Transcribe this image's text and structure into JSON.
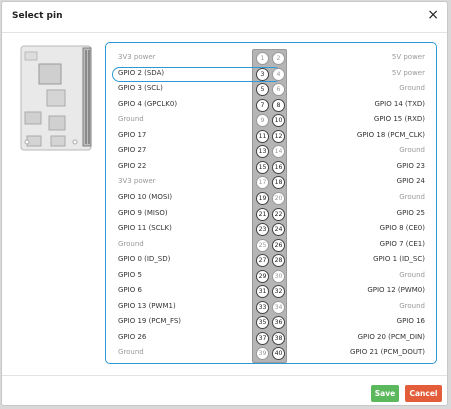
{
  "dialog": {
    "title": "Select pin",
    "close_glyph": "×",
    "save_label": "Save",
    "cancel_label": "Cancel"
  },
  "colors": {
    "accent": "#2d98d6",
    "save": "#5cb85c",
    "cancel": "#e35d3a"
  },
  "selected_pin": 3,
  "pins": [
    {
      "left": {
        "num": "1",
        "label": "3V3 power",
        "muted": true
      },
      "right": {
        "num": "2",
        "label": "5V power",
        "muted": true
      }
    },
    {
      "left": {
        "num": "3",
        "label": "GPIO 2 (SDA)",
        "muted": false
      },
      "right": {
        "num": "4",
        "label": "5V power",
        "muted": true
      }
    },
    {
      "left": {
        "num": "5",
        "label": "GPIO 3 (SCL)",
        "muted": false
      },
      "right": {
        "num": "6",
        "label": "Ground",
        "muted": true
      }
    },
    {
      "left": {
        "num": "7",
        "label": "GPIO 4 (GPCLK0)",
        "muted": false
      },
      "right": {
        "num": "8",
        "label": "GPIO 14 (TXD)",
        "muted": false
      }
    },
    {
      "left": {
        "num": "9",
        "label": "Ground",
        "muted": true
      },
      "right": {
        "num": "10",
        "label": "GPIO 15 (RXD)",
        "muted": false
      }
    },
    {
      "left": {
        "num": "11",
        "label": "GPIO 17",
        "muted": false
      },
      "right": {
        "num": "12",
        "label": "GPIO 18 (PCM_CLK)",
        "muted": false
      }
    },
    {
      "left": {
        "num": "13",
        "label": "GPIO 27",
        "muted": false
      },
      "right": {
        "num": "14",
        "label": "Ground",
        "muted": true
      }
    },
    {
      "left": {
        "num": "15",
        "label": "GPIO 22",
        "muted": false
      },
      "right": {
        "num": "16",
        "label": "GPIO 23",
        "muted": false
      }
    },
    {
      "left": {
        "num": "17",
        "label": "3V3 power",
        "muted": true
      },
      "right": {
        "num": "18",
        "label": "GPIO 24",
        "muted": false
      }
    },
    {
      "left": {
        "num": "19",
        "label": "GPIO 10 (MOSI)",
        "muted": false
      },
      "right": {
        "num": "20",
        "label": "Ground",
        "muted": true
      }
    },
    {
      "left": {
        "num": "21",
        "label": "GPIO 9 (MISO)",
        "muted": false
      },
      "right": {
        "num": "22",
        "label": "GPIO 25",
        "muted": false
      }
    },
    {
      "left": {
        "num": "23",
        "label": "GPIO 11 (SCLK)",
        "muted": false
      },
      "right": {
        "num": "24",
        "label": "GPIO 8 (CE0)",
        "muted": false
      }
    },
    {
      "left": {
        "num": "25",
        "label": "Ground",
        "muted": true
      },
      "right": {
        "num": "26",
        "label": "GPIO 7 (CE1)",
        "muted": false
      }
    },
    {
      "left": {
        "num": "27",
        "label": "GPIO 0 (ID_SD)",
        "muted": false
      },
      "right": {
        "num": "28",
        "label": "GPIO 1 (ID_SC)",
        "muted": false
      }
    },
    {
      "left": {
        "num": "29",
        "label": "GPIO 5",
        "muted": false
      },
      "right": {
        "num": "30",
        "label": "Ground",
        "muted": true
      }
    },
    {
      "left": {
        "num": "31",
        "label": "GPIO 6",
        "muted": false
      },
      "right": {
        "num": "32",
        "label": "GPIO 12 (PWM0)",
        "muted": false
      }
    },
    {
      "left": {
        "num": "33",
        "label": "GPIO 13 (PWM1)",
        "muted": false
      },
      "right": {
        "num": "34",
        "label": "Ground",
        "muted": true
      }
    },
    {
      "left": {
        "num": "35",
        "label": "GPIO 19 (PCM_FS)",
        "muted": false
      },
      "right": {
        "num": "36",
        "label": "GPIO 16",
        "muted": false
      }
    },
    {
      "left": {
        "num": "37",
        "label": "GPIO 26",
        "muted": false
      },
      "right": {
        "num": "38",
        "label": "GPIO 20 (PCM_DIN)",
        "muted": false
      }
    },
    {
      "left": {
        "num": "39",
        "label": "Ground",
        "muted": true
      },
      "right": {
        "num": "40",
        "label": "GPIO 21 (PCM_DOUT)",
        "muted": false
      }
    }
  ]
}
